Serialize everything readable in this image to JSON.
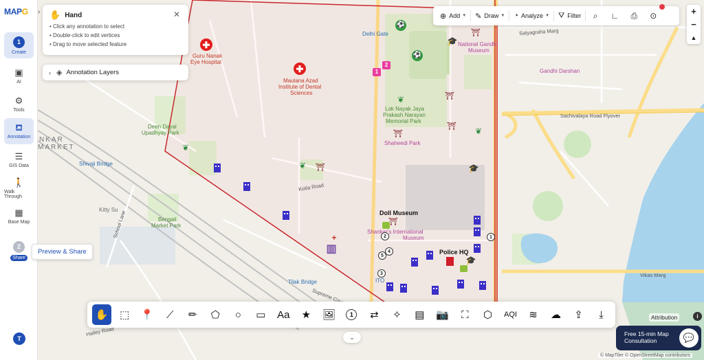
{
  "app": {
    "logo_main": "MAP",
    "logo_accent": "G"
  },
  "sidebar": {
    "items": [
      {
        "label": "Create",
        "step": "1"
      },
      {
        "label": "AI"
      },
      {
        "label": "Tools"
      },
      {
        "label": "Annotation"
      },
      {
        "label": "GIS Data"
      },
      {
        "label": "Walk Through"
      },
      {
        "label": "Base Map"
      },
      {
        "label": "Share",
        "step": "2"
      }
    ],
    "tooltip": "Preview & Share",
    "avatar": "T"
  },
  "hand_panel": {
    "title": "Hand",
    "hints": [
      "• Click any annotation to select",
      "• Double-click to edit vertices",
      "• Drag to move selected feature"
    ]
  },
  "layers_panel": {
    "title": "Annotation Layers"
  },
  "top_toolbar": {
    "add": "Add",
    "draw": "Draw",
    "analyze": "Analyze",
    "filter": "Filter"
  },
  "zoom": {
    "in": "+",
    "out": "−"
  },
  "bottom_toolbar": {
    "tools": [
      "hand-tool",
      "select-tool",
      "marker-tool",
      "line-tool",
      "freehand-tool",
      "polygon-tool",
      "circle-tool",
      "rectangle-tool",
      "text-tool",
      "star-tool",
      "image-tool",
      "number-tool",
      "route-tool",
      "shape-tool",
      "building-tool",
      "camera-tool",
      "photo-tool",
      "3d-box-tool",
      "aqi-tool",
      "wind-tool",
      "weather-tool",
      "upload-tool",
      "download-tool"
    ],
    "text_label": "Aa",
    "number_label": "1",
    "aqi_label": "AQI"
  },
  "consult": {
    "line1": "Free 15-min Map",
    "line2": "Consultation"
  },
  "attribution": {
    "label": "Attribution",
    "info": "i",
    "credits": "© MapTiler © OpenStreetMap contributors"
  },
  "map": {
    "labels": {
      "delhi_gate": "Delhi Gate",
      "satyagraha_marg": "Satyagraha Marg",
      "national_gandhi_1": "National Gandhi",
      "national_gandhi_2": "Museum",
      "gandhi_darshan": "Gandhi Darshan",
      "guru_nanak_1": "Guru Nanak",
      "guru_nanak_2": "Eye Hospital",
      "maulana_1": "Maulana Azad",
      "maulana_2": "Institute of Dental",
      "maulana_3": "Sciences",
      "lok_nayak_1": "Lok Nayak Jaya",
      "lok_nayak_2": "Prakash Narayan",
      "lok_nayak_3": "Memorial Park",
      "sachivalaya_flyover": "Sachivalaya Road Flyover",
      "shaheedi_park": "Shaheedi Park",
      "deen_dayal_1": "Deen Dayal",
      "deen_dayal_2": "Upadhyay Park",
      "nkar_market_1": "NKAR",
      "nkar_market_2": "MARKET",
      "shivaji_bridge": "Shivaji Bridge",
      "kotla_road": "Kotla Road",
      "kitty_su": "Kitty Su",
      "school_lane": "School Lane",
      "bengali_1": "Bengali",
      "bengali_2": "Market Park",
      "doll_museum": "Doll Museum",
      "shankar_1": "Shankar's International",
      "shankar_2": "Museum",
      "police_hq": "Police HQ",
      "tilak_bridge": "Tilak Bridge",
      "ito": "ITO",
      "vikas_marg": "Vikas Marg",
      "supreme_court": "Supreme Court Road",
      "hailey_road": "Hailey Road",
      "pink_badge_1": "1",
      "pink_badge_2": "2",
      "num_1": "1",
      "num_2": "2",
      "num_3": "3",
      "num_4": "4",
      "num_5": "5"
    }
  }
}
